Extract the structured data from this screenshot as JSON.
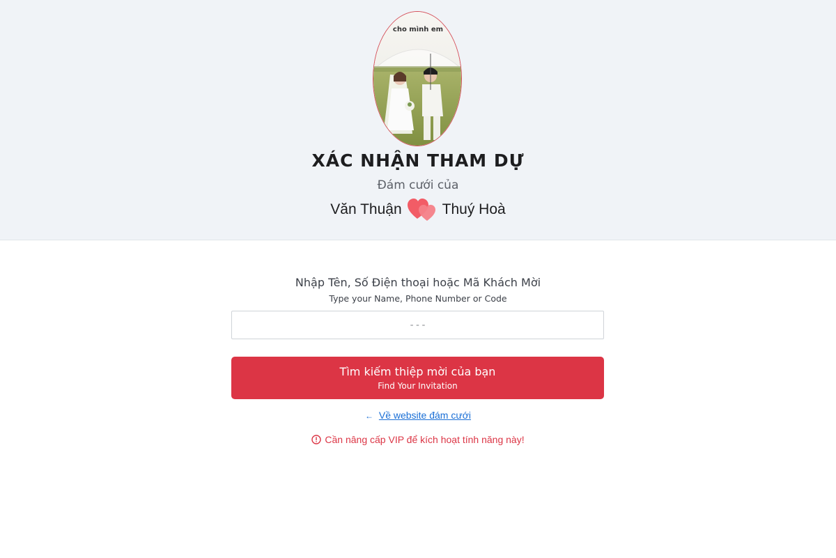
{
  "header": {
    "title": "XÁC NHẬN THAM DỰ",
    "subtitle": "Đám cưới của",
    "groom_name": "Văn Thuận",
    "bride_name": "Thuý Hoà",
    "photo_caption": "cho mình em"
  },
  "search": {
    "prompt": "Nhập Tên, Số Điện thoại hoặc Mã Khách Mời",
    "prompt_en": "Type your Name, Phone Number or Code",
    "placeholder": "---",
    "value": ""
  },
  "find_button": {
    "label": "Tìm kiếm thiệp mời của bạn",
    "label_en": "Find Your Invitation"
  },
  "back_link": {
    "arrow": "←",
    "label": "Về website đám cưới"
  },
  "warning": {
    "icon": "alert-circle-icon",
    "text": "Cần nâng cấp VIP để kích hoạt tính năng này!"
  },
  "colors": {
    "accent": "#dc3545",
    "header_bg": "#f0f3f7",
    "link": "#1a6fd6",
    "heart": "#f25c66"
  }
}
